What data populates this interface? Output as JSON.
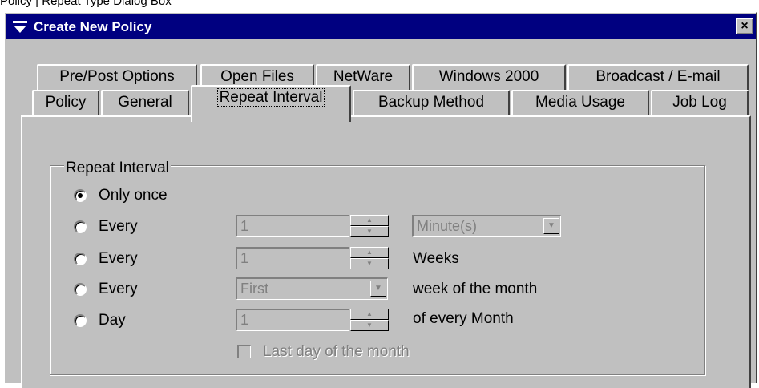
{
  "caption": "Policy | Repeat Type Dialog Box",
  "window": {
    "title": "Create New Policy",
    "close_label": "×"
  },
  "tabs": {
    "row1": [
      "Pre/Post Options",
      "Open Files",
      "NetWare",
      "Windows 2000",
      "Broadcast / E-mail"
    ],
    "row2": [
      "Policy",
      "General",
      "Repeat Interval",
      "Backup Method",
      "Media Usage",
      "Job Log"
    ],
    "active": "Repeat Interval"
  },
  "repeat_group": {
    "label": "Repeat Interval",
    "options": [
      {
        "label": "Only once",
        "checked": true
      },
      {
        "label": "Every",
        "checked": false,
        "value": "1",
        "unit_select": "Minute(s)"
      },
      {
        "label": "Every",
        "checked": false,
        "value": "1",
        "unit_text": "Weeks"
      },
      {
        "label": "Every",
        "checked": false,
        "select": "First",
        "unit_text": "week of the month"
      },
      {
        "label": "Day",
        "checked": false,
        "value": "1",
        "unit_text": "of every Month"
      }
    ],
    "last_day_checkbox": {
      "label": "Last day of the month",
      "checked": false,
      "enabled": false
    }
  }
}
